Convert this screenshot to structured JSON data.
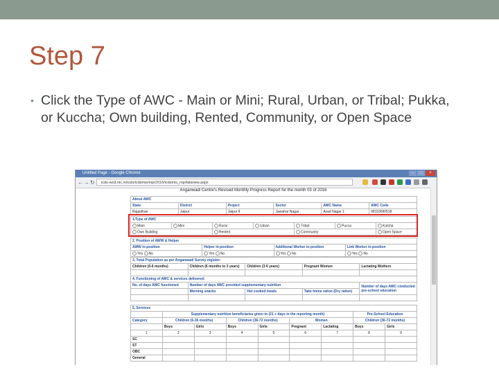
{
  "slide": {
    "title": "Step 7",
    "bullet": "Click the Type of AWC  - Main or Mini; Rural, Urban, or Tribal; Pukka, or Kuccha; Own building, Rented, Community, or Open Space"
  },
  "browser": {
    "window_title": "Untitled Page - Google Chrome",
    "url": "icds-wcd.nic.in/icds/icdsmis/mpr2016/icdsmis_mprfatanew.aspx"
  },
  "form": {
    "header": "Anganwadi Centre's Revised Monthly Progress Report for the month 03 of 2016",
    "about": {
      "section": "About AWC",
      "headers": [
        "State",
        "District",
        "Project",
        "Sector",
        "AWC Name",
        "AWC Code"
      ],
      "values": [
        "Rajasthan",
        "Jaipur",
        "Jaipur II",
        "Jawahar Nagar",
        "Azad Nagar 1",
        "08110090518"
      ]
    },
    "type": {
      "section": "1.Type of AWC",
      "row1": [
        "Main",
        "Mini",
        "Rural",
        "Urban",
        "Tribal",
        "Pucca",
        "Kutcha"
      ],
      "row2": [
        "Own Building",
        "Rented",
        "Community",
        "Open Space"
      ]
    },
    "position": {
      "section": "2. Position of AWW & Helper",
      "headers": [
        "AWW in-position",
        "Helper in-position",
        "Additional Worker in-position",
        "Link Worker in-position"
      ],
      "yes": "Yes",
      "no": "No"
    },
    "population": {
      "section": "3. Total Population as per Anganwadi Survey register:",
      "headers": [
        "Children (0-6 months)",
        "Children (6 months to 3 years)",
        "Children (3-6 years)",
        "Pregnant Women",
        "Lactating Mothers"
      ]
    },
    "functioning": {
      "section": "4. Functioning of AWC & services delivered:",
      "days_open": "No. of days AWC functioned",
      "snp_days": "Number of days AWC provided supplementary nutrition",
      "morning": "Morning snacks",
      "hot": "Hot cooked meals",
      "thr": "Take home ration (Dry ration)",
      "pse_days": "Number of days AWC conducted pre-school education"
    },
    "services": {
      "section": "5. Services",
      "snp_head": "Supplementary nutrition beneficiaries given to (21 + days in the reporting month)",
      "pse_head": "Pre-School Education",
      "category": "Category",
      "groups": [
        "Children (6-36 months)",
        "Children (36-72 months)",
        "Women",
        "Children (36-72 months)"
      ],
      "sub": [
        "Boys",
        "Girls",
        "Boys",
        "Girls",
        "Pregnant",
        "Lactating",
        "Boys",
        "Girls"
      ],
      "numbers": [
        "1",
        "2",
        "3",
        "4",
        "5",
        "6",
        "7",
        "8",
        "9"
      ],
      "rows": [
        "SC",
        "ST",
        "OBC",
        "General"
      ]
    }
  }
}
